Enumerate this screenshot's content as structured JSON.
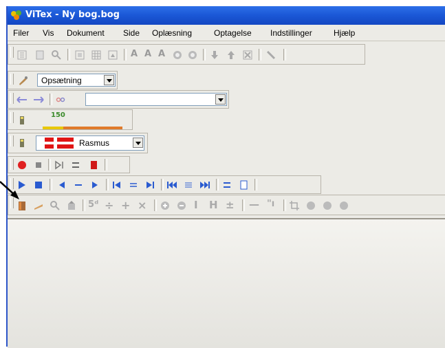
{
  "window": {
    "title": "ViTex - Ny bog.bog"
  },
  "menubar": {
    "items": [
      "Filer",
      "Vis",
      "Dokument",
      "Side",
      "Oplæsning",
      "Optagelse",
      "Indstillinger",
      "Hjælp"
    ]
  },
  "toolbar_setup": {
    "combo_value": "Opsætning"
  },
  "toolbar_navigation": {
    "combo_value": ""
  },
  "toolbar_speed": {
    "value": "150"
  },
  "toolbar_voice": {
    "voice_name": "Rasmus"
  },
  "colors": {
    "titlebar": "#1a57d6",
    "record_red": "#e02020",
    "play_blue": "#2a5bd0"
  }
}
